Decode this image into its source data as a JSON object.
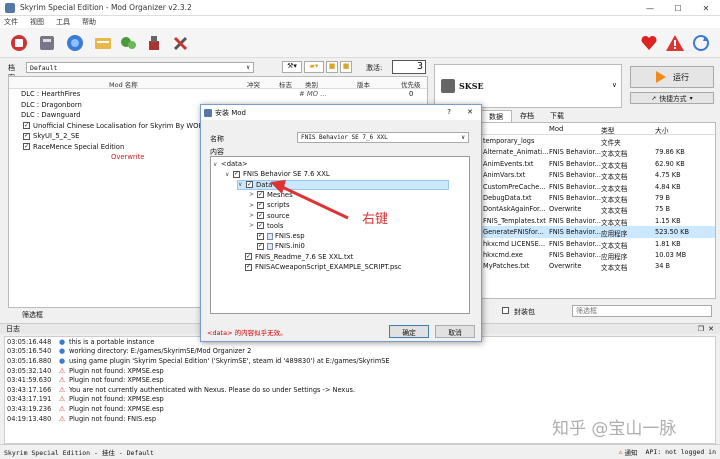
{
  "window": {
    "title": "Skyrim Special Edition - Mod Organizer v2.3.2",
    "min": "—",
    "max": "☐",
    "close": "✕"
  },
  "menu": [
    "文件",
    "视图",
    "工具",
    "帮助"
  ],
  "profile": {
    "label": "档案",
    "value": "Default",
    "active_label": "激活:",
    "active_count": "3"
  },
  "modlist": {
    "headers": [
      "Mod 名称",
      "冲突",
      "标志",
      "类别",
      "版本",
      "优先级"
    ],
    "rows": [
      {
        "name": "DLC : HearthFires",
        "checkbox": false,
        "category": "# MO ...",
        "priority": "0"
      },
      {
        "name": "DLC : Dragonborn",
        "checkbox": false,
        "category": "",
        "priority": ""
      },
      {
        "name": "DLC : Dawnguard",
        "checkbox": false,
        "category": "",
        "priority": ""
      },
      {
        "name": "Unofficial Chinese Localisation for Skyrim By WOK S",
        "checkbox": true,
        "category": "",
        "priority": ""
      },
      {
        "name": "SkyUI_5_2_SE",
        "checkbox": true,
        "category": "",
        "priority": ""
      },
      {
        "name": "RaceMence Special Edition",
        "checkbox": true,
        "category": "",
        "priority": ""
      }
    ],
    "overwrite": "Overwrite",
    "filter_label": "筛选框"
  },
  "right": {
    "game": "SKSE",
    "run_label": "运行",
    "shortcut_label": "快捷方式",
    "tabs": [
      "数据",
      "存档",
      "下载"
    ],
    "headers": [
      "Mod",
      "类型",
      "大小"
    ],
    "files": [
      {
        "name": "temporary_logs",
        "mod": "",
        "type": "文件夹",
        "size": ""
      },
      {
        "name": "Alternate_Animati...",
        "mod": "FNIS Behavior...",
        "type": "文本文档",
        "size": "79.86 KB"
      },
      {
        "name": "AnimEvents.txt",
        "mod": "FNIS Behavior...",
        "type": "文本文档",
        "size": "62.90 KB"
      },
      {
        "name": "AnimVars.txt",
        "mod": "FNIS Behavior...",
        "type": "文本文档",
        "size": "4.75 KB"
      },
      {
        "name": "CustomPreCache...",
        "mod": "FNIS Behavior...",
        "type": "文本文档",
        "size": "4.84 KB"
      },
      {
        "name": "DebugData.txt",
        "mod": "FNIS Behavior...",
        "type": "文本文档",
        "size": "79 B"
      },
      {
        "name": "DontAskAgainFor...",
        "mod": "Overwrite",
        "type": "文本文档",
        "size": "75 B"
      },
      {
        "name": "FNIS_Templates.txt",
        "mod": "FNIS Behavior...",
        "type": "文本文档",
        "size": "1.15 KB"
      },
      {
        "name": "GenerateFNISfor...",
        "mod": "FNIS Behavior...",
        "type": "应用程序",
        "size": "523.50 KB"
      },
      {
        "name": "hkxcmd LICENSE...",
        "mod": "FNIS Behavior...",
        "type": "文本文档",
        "size": "1.81 KB"
      },
      {
        "name": "hkxcmd.exe",
        "mod": "FNIS Behavior...",
        "type": "应用程序",
        "size": "10.03 MB"
      },
      {
        "name": "MyPatches.txt",
        "mod": "Overwrite",
        "type": "文本文档",
        "size": "34 B"
      }
    ],
    "archive_label": "封装包",
    "filter_placeholder": "筛选框"
  },
  "dialog": {
    "title": "安装 Mod",
    "name_label": "名称",
    "name_value": "FNIS Behavior SE 7_6 XXL",
    "content_label": "内容",
    "tree": [
      {
        "label": "<data>",
        "depth": 0,
        "arrow": "∨",
        "checkbox": false
      },
      {
        "label": "FNIS Behavior SE 7.6 XXL",
        "depth": 1,
        "arrow": "∨",
        "checkbox": true
      },
      {
        "label": "Data",
        "depth": 2,
        "arrow": "∨",
        "checkbox": true,
        "selected": true
      },
      {
        "label": "Meshes",
        "depth": 3,
        "arrow": ">",
        "checkbox": true
      },
      {
        "label": "scripts",
        "depth": 3,
        "arrow": ">",
        "checkbox": true
      },
      {
        "label": "source",
        "depth": 3,
        "arrow": ">",
        "checkbox": true
      },
      {
        "label": "tools",
        "depth": 3,
        "arrow": ">",
        "checkbox": true
      },
      {
        "label": "FNIS.esp",
        "depth": 3,
        "arrow": "",
        "checkbox": true
      },
      {
        "label": "FNIS.ini0",
        "depth": 3,
        "arrow": "",
        "checkbox": true
      },
      {
        "label": "FNIS_Readme_7.6 SE XXL.txt",
        "depth": 2,
        "arrow": "",
        "checkbox": true
      },
      {
        "label": "FNISACweaponScript_EXAMPLE_SCRIPT.psc",
        "depth": 2,
        "arrow": "",
        "checkbox": true
      }
    ],
    "warning": "<data> 的内容似乎无效。",
    "ok": "确定",
    "cancel": "取消",
    "help": "?",
    "close": "✕"
  },
  "annotation": "右键",
  "log": {
    "label": "日志",
    "entries": [
      {
        "time": "03:05:16.448",
        "icon": "info",
        "text": "this is a portable instance"
      },
      {
        "time": "03:05:16.540",
        "icon": "info",
        "text": "working directory: E:/games/SkyrimSE/Mod Organizer 2"
      },
      {
        "time": "03:05:16.880",
        "icon": "info",
        "text": "using game plugin 'Skyrim Special Edition' ('SkyrimSE', steam id '489830') at E:/games/SkyrimSE"
      },
      {
        "time": "03:05:32.140",
        "icon": "warn",
        "text": "Plugin not found: XPMSE.esp"
      },
      {
        "time": "03:41:59.630",
        "icon": "warn",
        "text": "Plugin not found: XPMSE.esp"
      },
      {
        "time": "03:43:17.166",
        "icon": "warn",
        "text": "You are not currently authenticated with Nexus. Please do so under Settings -> Nexus."
      },
      {
        "time": "03:43:17.191",
        "icon": "warn",
        "text": "Plugin not found: XPMSE.esp"
      },
      {
        "time": "03:43:19.236",
        "icon": "warn",
        "text": "Plugin not found: XPMSE.esp"
      },
      {
        "time": "04:19:13.480",
        "icon": "warn",
        "text": "Plugin not found: FNIS.esp"
      }
    ]
  },
  "status": {
    "text": "Skyrim Special Edition - 挂住 - Default",
    "notify": "通知",
    "api": "API: not logged in"
  },
  "watermark": "知乎 @宝山一脉",
  "colors": {
    "accent": "#cc3322",
    "selection": "#cce8ff",
    "run": "#f08a1c"
  }
}
